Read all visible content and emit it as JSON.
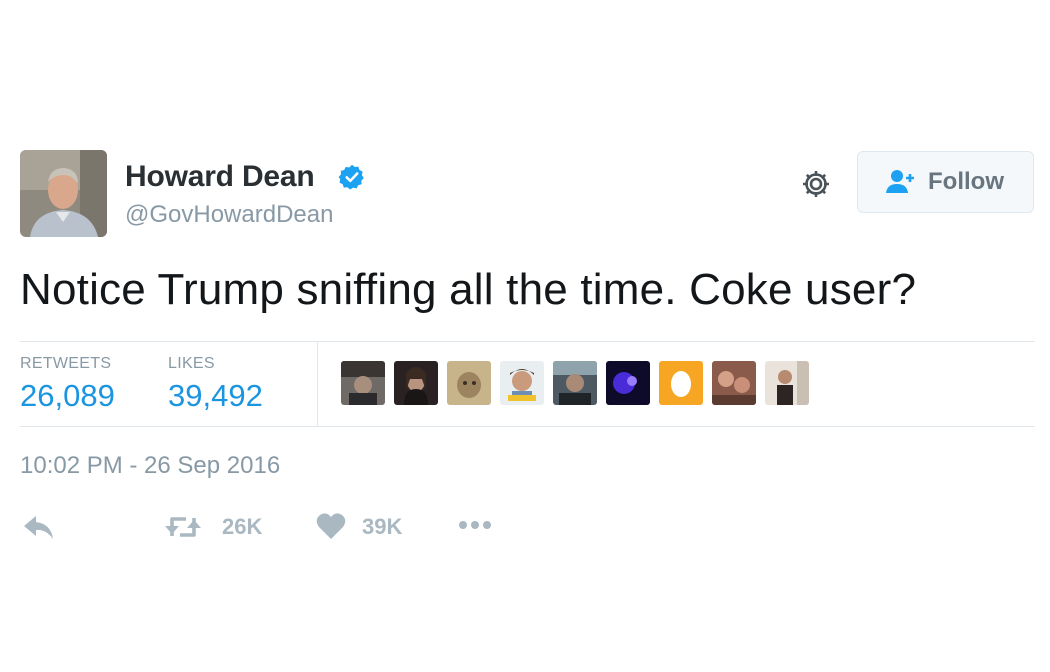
{
  "user": {
    "name": "Howard Dean",
    "handle": "@GovHowardDean",
    "verified": true
  },
  "follow_button": {
    "label": "Follow"
  },
  "tweet": {
    "text": "Notice Trump sniffing all the time. Coke user?",
    "timestamp": "10:02 PM - 26 Sep 2016"
  },
  "stats": {
    "retweets_label": "RETWEETS",
    "retweets_value": "26,089",
    "likes_label": "LIKES",
    "likes_value": "39,492"
  },
  "actions": {
    "reply_icon": "reply-icon",
    "retweet_count": "26K",
    "like_count": "39K",
    "more_icon": "more-icon"
  },
  "colors": {
    "link_blue": "#1b95e0",
    "verified_blue": "#1da1f2",
    "muted_gray": "#8899a6",
    "action_gray": "#aab8c2"
  }
}
